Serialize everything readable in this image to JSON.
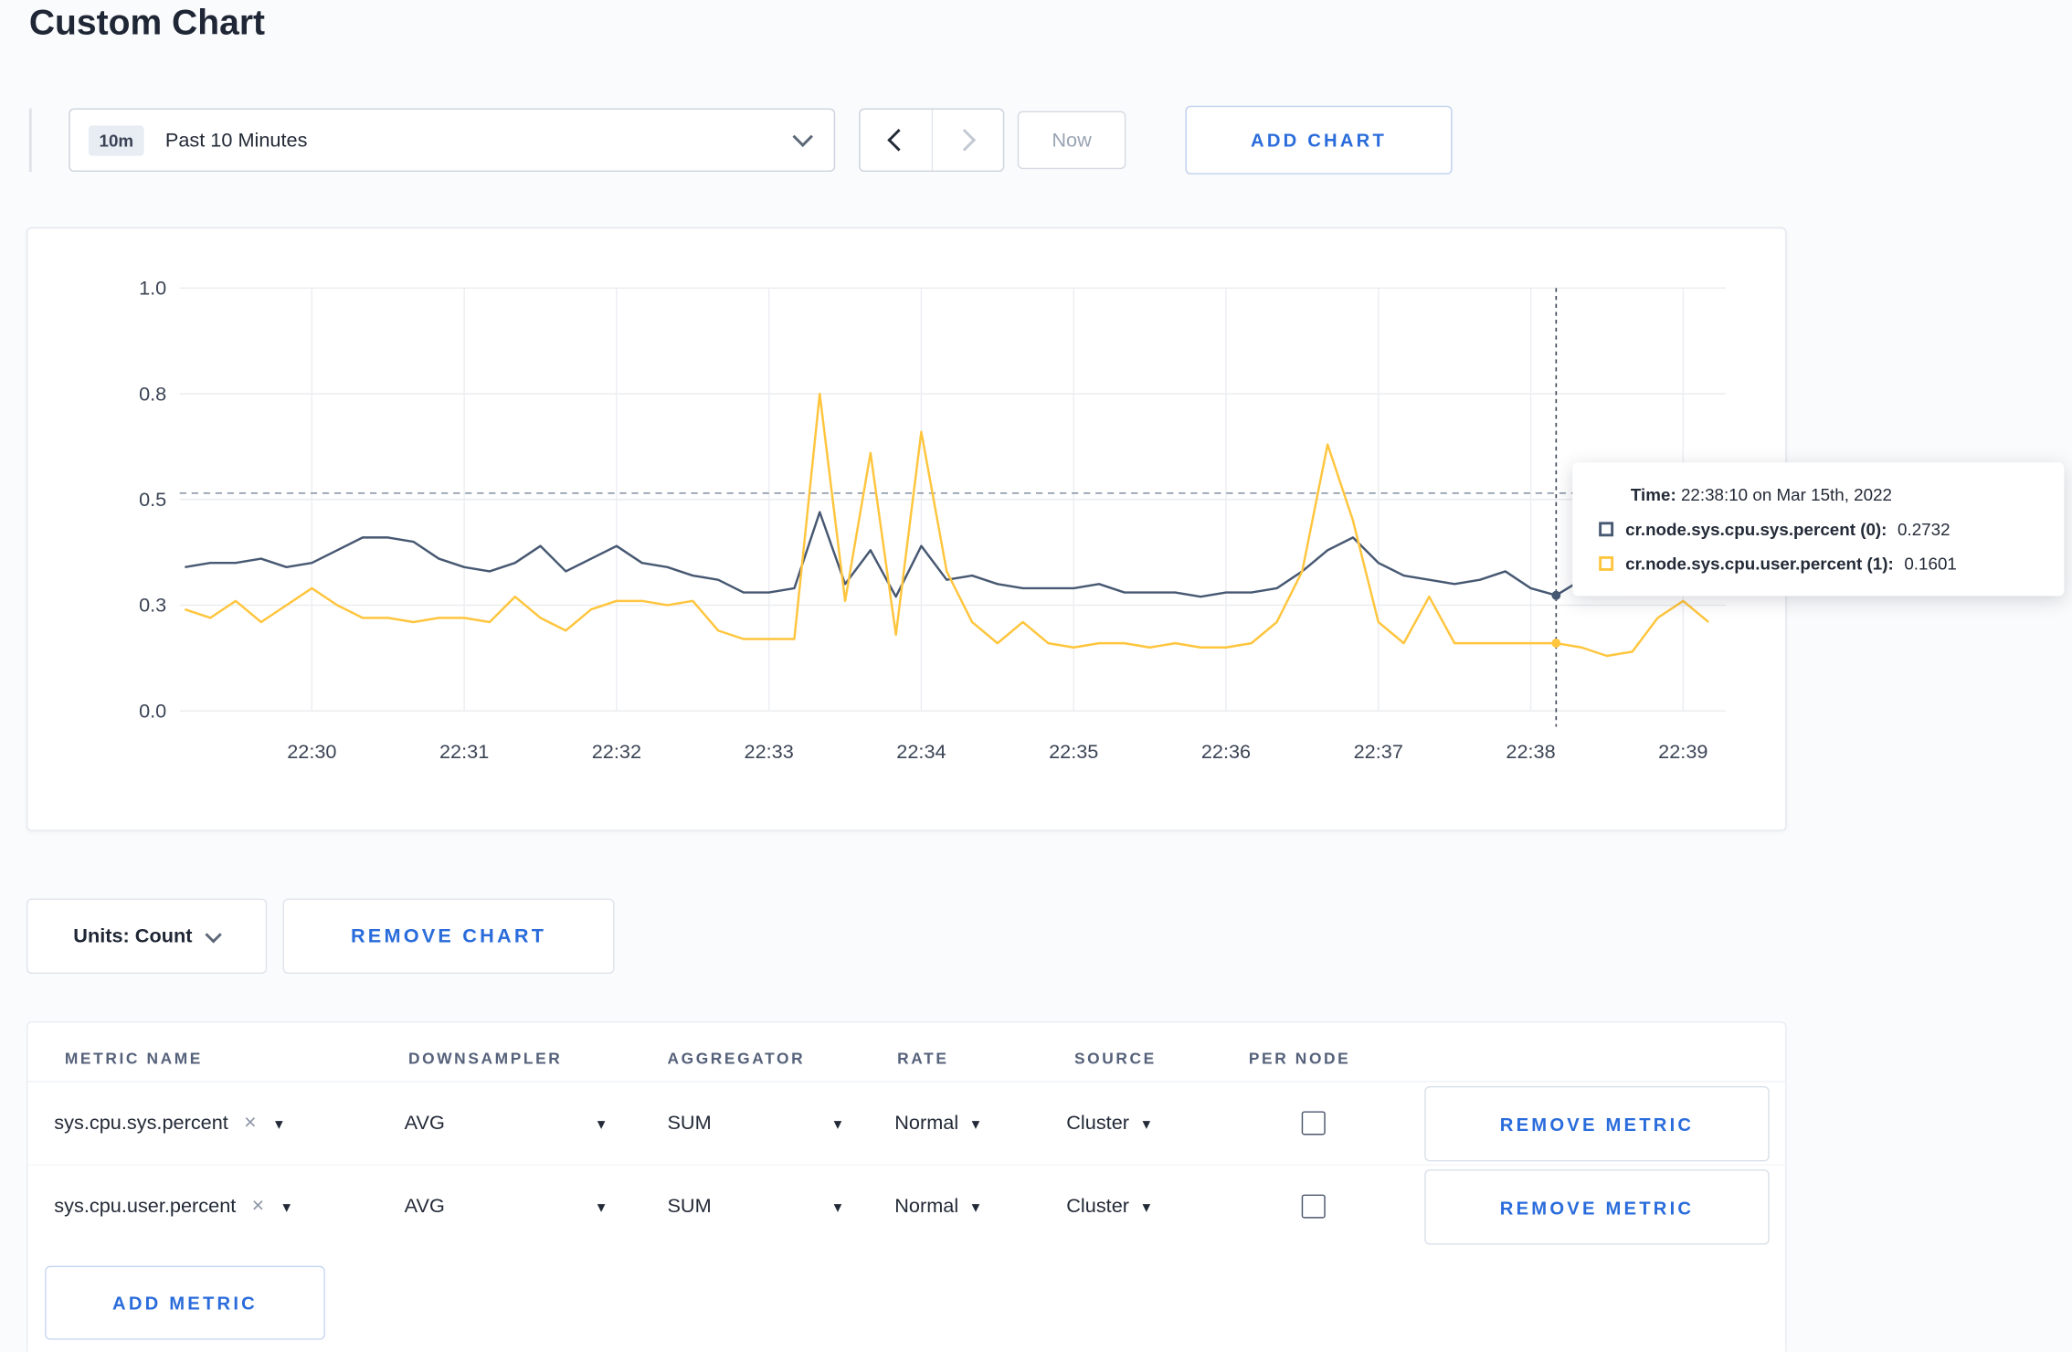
{
  "page": {
    "title": "Custom Chart"
  },
  "toolbar": {
    "time_window_badge": "10m",
    "time_window_label": "Past 10 Minutes",
    "now_label": "Now",
    "add_chart_label": "ADD CHART"
  },
  "tooltip": {
    "time_label": "Time:",
    "time_value": "22:38:10 on Mar 15th, 2022",
    "series": [
      {
        "label": "cr.node.sys.cpu.sys.percent (0):",
        "value": "0.2732"
      },
      {
        "label": "cr.node.sys.cpu.user.percent (1):",
        "value": "0.1601"
      }
    ]
  },
  "chart_controls": {
    "units_label": "Units: Count",
    "remove_chart_label": "REMOVE CHART"
  },
  "metrics_table": {
    "headers": [
      "METRIC NAME",
      "DOWNSAMPLER",
      "AGGREGATOR",
      "RATE",
      "SOURCE",
      "PER NODE"
    ],
    "rows": [
      {
        "metric": "sys.cpu.sys.percent",
        "downsampler": "AVG",
        "aggregator": "SUM",
        "rate": "Normal",
        "source": "Cluster",
        "per_node_checked": false,
        "remove_label": "REMOVE METRIC"
      },
      {
        "metric": "sys.cpu.user.percent",
        "downsampler": "AVG",
        "aggregator": "SUM",
        "rate": "Normal",
        "source": "Cluster",
        "per_node_checked": false,
        "remove_label": "REMOVE METRIC"
      }
    ],
    "add_metric_label": "ADD METRIC"
  },
  "chart_data": {
    "type": "line",
    "x_ticks": [
      "22:30",
      "22:31",
      "22:32",
      "22:33",
      "22:34",
      "22:35",
      "22:36",
      "22:37",
      "22:38",
      "22:39"
    ],
    "y_ticks": [
      {
        "label": "0.0",
        "value": 0
      },
      {
        "label": "0.3",
        "value": 0.25
      },
      {
        "label": "0.5",
        "value": 0.5
      },
      {
        "label": "0.8",
        "value": 0.75
      },
      {
        "label": "1.0",
        "value": 1.0
      }
    ],
    "ylim": [
      0,
      1
    ],
    "grid": true,
    "x_start_time": "22:29:10",
    "x_step_seconds": 10,
    "x_first_point_offset_s": -50,
    "threshold_value": 0.515,
    "crosshair": {
      "index": 54,
      "time": "22:38:10"
    },
    "series": [
      {
        "name": "cr.node.sys.cpu.sys.percent",
        "color": "#475872",
        "values": [
          0.34,
          0.35,
          0.35,
          0.36,
          0.34,
          0.35,
          0.38,
          0.41,
          0.41,
          0.4,
          0.36,
          0.34,
          0.33,
          0.35,
          0.39,
          0.33,
          0.36,
          0.39,
          0.35,
          0.34,
          0.32,
          0.31,
          0.28,
          0.28,
          0.29,
          0.47,
          0.3,
          0.38,
          0.27,
          0.39,
          0.31,
          0.32,
          0.3,
          0.29,
          0.29,
          0.29,
          0.3,
          0.28,
          0.28,
          0.28,
          0.27,
          0.28,
          0.28,
          0.29,
          0.33,
          0.38,
          0.41,
          0.35,
          0.32,
          0.31,
          0.3,
          0.31,
          0.33,
          0.29,
          0.2732,
          0.31,
          0.32,
          0.3,
          0.3,
          0.31,
          0.3
        ]
      },
      {
        "name": "cr.node.sys.cpu.user.percent",
        "color": "#ffc53d",
        "values": [
          0.24,
          0.22,
          0.26,
          0.21,
          0.25,
          0.29,
          0.25,
          0.22,
          0.22,
          0.21,
          0.22,
          0.22,
          0.21,
          0.27,
          0.22,
          0.19,
          0.24,
          0.26,
          0.26,
          0.25,
          0.26,
          0.19,
          0.17,
          0.17,
          0.17,
          0.75,
          0.26,
          0.61,
          0.18,
          0.66,
          0.33,
          0.21,
          0.16,
          0.21,
          0.16,
          0.15,
          0.16,
          0.16,
          0.15,
          0.16,
          0.15,
          0.15,
          0.16,
          0.21,
          0.33,
          0.63,
          0.45,
          0.21,
          0.16,
          0.27,
          0.16,
          0.16,
          0.16,
          0.16,
          0.1601,
          0.15,
          0.13,
          0.14,
          0.22,
          0.26,
          0.21
        ]
      }
    ]
  }
}
